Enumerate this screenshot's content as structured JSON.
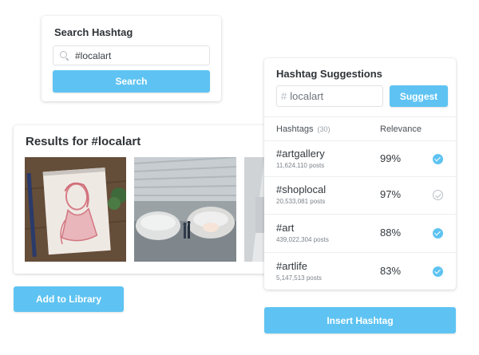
{
  "search": {
    "title": "Search Hashtag",
    "value": "#localart",
    "button": "Search"
  },
  "results": {
    "title": "Results for #localart"
  },
  "add_button": "Add to Library",
  "suggestions": {
    "title": "Hashtag Suggestions",
    "input_value": "localart",
    "suggest_button": "Suggest",
    "col_hashtags": "Hashtags",
    "count": "(30)",
    "col_relevance": "Relevance",
    "rows": [
      {
        "tag": "#artgallery",
        "posts": "11,624,110 posts",
        "relevance": "99%",
        "checked": true
      },
      {
        "tag": "#shoplocal",
        "posts": "20,533,081 posts",
        "relevance": "97%",
        "checked": false
      },
      {
        "tag": "#art",
        "posts": "439,022,304 posts",
        "relevance": "88%",
        "checked": true
      },
      {
        "tag": "#artlife",
        "posts": "5,147,513 posts",
        "relevance": "83%",
        "checked": true
      }
    ]
  },
  "insert_button": "Insert Hashtag",
  "colors": {
    "accent": "#5ec3f2"
  }
}
